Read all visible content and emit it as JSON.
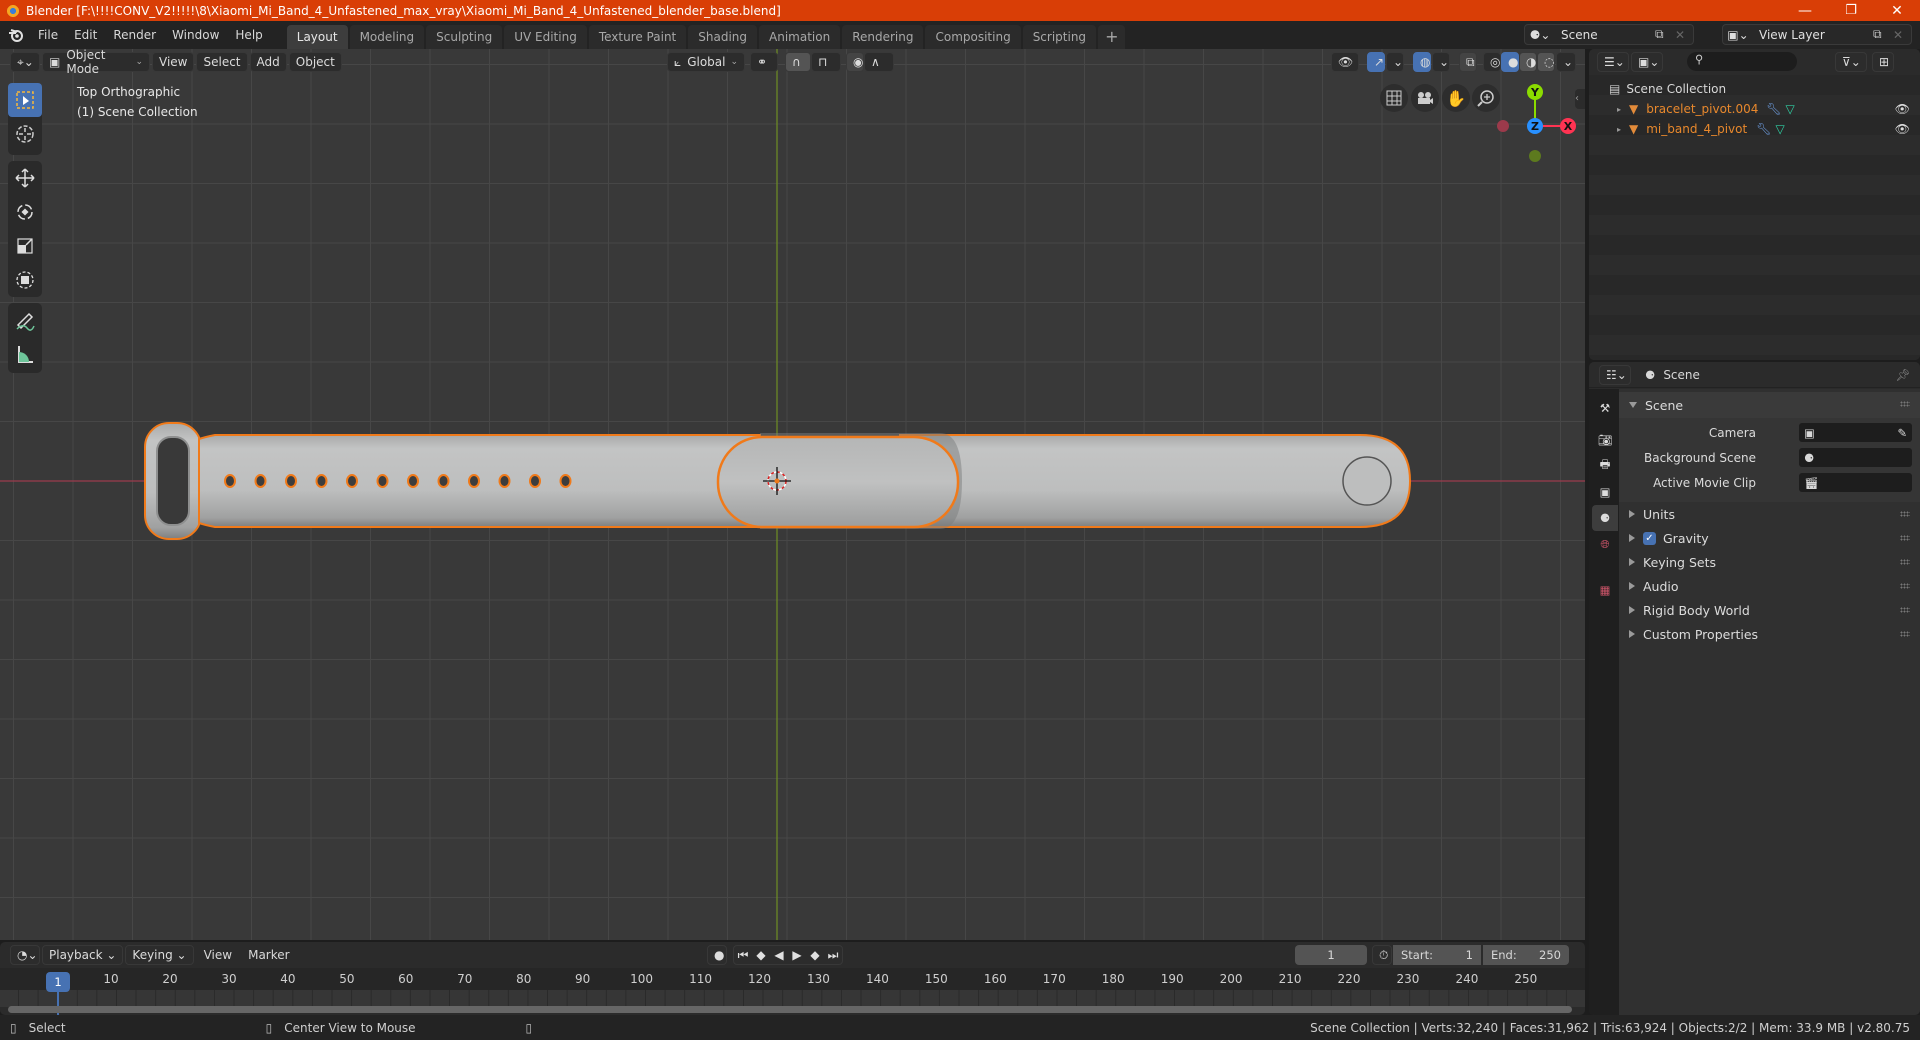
{
  "window": {
    "title": "Blender [F:\\!!!!CONV_V2!!!!!\\8\\Xiaomi_Mi_Band_4_Unfastened_max_vray\\Xiaomi_Mi_Band_4_Unfastened_blender_base.blend]",
    "controls": {
      "minimize": "—",
      "maximize": "❐",
      "close": "✕"
    }
  },
  "menu": [
    "File",
    "Edit",
    "Render",
    "Window",
    "Help"
  ],
  "workspace_tabs": [
    {
      "label": "Layout",
      "active": true
    },
    {
      "label": "Modeling",
      "active": false
    },
    {
      "label": "Sculpting",
      "active": false
    },
    {
      "label": "UV Editing",
      "active": false
    },
    {
      "label": "Texture Paint",
      "active": false
    },
    {
      "label": "Shading",
      "active": false
    },
    {
      "label": "Animation",
      "active": false
    },
    {
      "label": "Rendering",
      "active": false
    },
    {
      "label": "Compositing",
      "active": false
    },
    {
      "label": "Scripting",
      "active": false
    }
  ],
  "add_workspace": "+",
  "scene_selector": {
    "value": "Scene"
  },
  "view_layer_selector": {
    "value": "View Layer"
  },
  "viewport_header": {
    "mode": "Object Mode",
    "menus": [
      "View",
      "Select",
      "Add",
      "Object"
    ],
    "transform_orientation": "Global"
  },
  "viewport": {
    "view_name": "Top Orthographic",
    "collection_label": "(1) Scene Collection",
    "gizmo": {
      "y": "Y",
      "z": "Z",
      "x": "X"
    },
    "axis_colors": {
      "x": "#ff3352",
      "y": "#8bdc00",
      "z": "#2890ff"
    },
    "selection_color": "#f07a1a",
    "strap_holes": 12
  },
  "outliner": {
    "root": "Scene Collection",
    "items": [
      {
        "name": "bracelet_pivot.004",
        "visible": true
      },
      {
        "name": "mi_band_4_pivot",
        "visible": true
      }
    ]
  },
  "properties": {
    "context": "Scene",
    "panel_title": "Scene",
    "fields": [
      {
        "label": "Camera",
        "value": ""
      },
      {
        "label": "Background Scene",
        "value": ""
      },
      {
        "label": "Active Movie Clip",
        "value": ""
      }
    ],
    "subpanels": [
      {
        "label": "Units"
      },
      {
        "label": "Gravity",
        "checkbox": true,
        "checked": true
      },
      {
        "label": "Keying Sets"
      },
      {
        "label": "Audio"
      },
      {
        "label": "Rigid Body World"
      },
      {
        "label": "Custom Properties"
      }
    ]
  },
  "timeline": {
    "menus": [
      "Playback",
      "Keying",
      "View",
      "Marker"
    ],
    "current_frame": "1",
    "start_label": "Start:",
    "start": "1",
    "end_label": "End:",
    "end": "250",
    "ticks": [
      "10",
      "20",
      "30",
      "40",
      "50",
      "60",
      "70",
      "80",
      "90",
      "100",
      "110",
      "120",
      "130",
      "140",
      "150",
      "160",
      "170",
      "180",
      "190",
      "200",
      "210",
      "220",
      "230",
      "240",
      "250"
    ],
    "playhead_label": "1"
  },
  "statusbar": {
    "left_action": "Select",
    "middle_action": "Center View to Mouse",
    "stats": "Scene Collection | Verts:32,240 | Faces:31,962 | Tris:63,924 | Objects:2/2 | Mem: 33.9 MB | v2.80.75"
  }
}
